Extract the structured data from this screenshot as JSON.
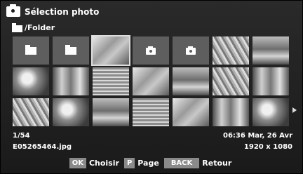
{
  "header": {
    "title": "Sélection photo",
    "icon": "camera-icon"
  },
  "path": {
    "label": "/Folder",
    "icon": "folder-icon"
  },
  "grid": {
    "columns": 7,
    "rows": 3,
    "selected_index": 2,
    "thumbnails": [
      {
        "type": "folder"
      },
      {
        "type": "folder"
      },
      {
        "type": "photo",
        "style": "a"
      },
      {
        "type": "camera"
      },
      {
        "type": "camera"
      },
      {
        "type": "photo",
        "style": "b"
      },
      {
        "type": "photo",
        "style": "c"
      },
      {
        "type": "photo",
        "style": "d"
      },
      {
        "type": "photo",
        "style": "e"
      },
      {
        "type": "photo",
        "style": "f"
      },
      {
        "type": "photo",
        "style": "a"
      },
      {
        "type": "photo",
        "style": "c"
      },
      {
        "type": "photo",
        "style": "b"
      },
      {
        "type": "photo",
        "style": "e"
      },
      {
        "type": "photo",
        "style": "b"
      },
      {
        "type": "photo",
        "style": "d"
      },
      {
        "type": "photo",
        "style": "c"
      },
      {
        "type": "photo",
        "style": "f"
      },
      {
        "type": "photo",
        "style": "a"
      },
      {
        "type": "photo",
        "style": "e"
      },
      {
        "type": "photo",
        "style": "d"
      }
    ]
  },
  "info": {
    "counter": "1/54",
    "filename": "E05265464.jpg",
    "datetime": "06:36 Mar, 26 Avr",
    "resolution": "1920 x 1080"
  },
  "footer": {
    "ok_key": "OK",
    "ok_label": "Choisir",
    "page_key": "P",
    "page_label": "Page",
    "back_key": "BACK",
    "back_label": "Retour"
  }
}
